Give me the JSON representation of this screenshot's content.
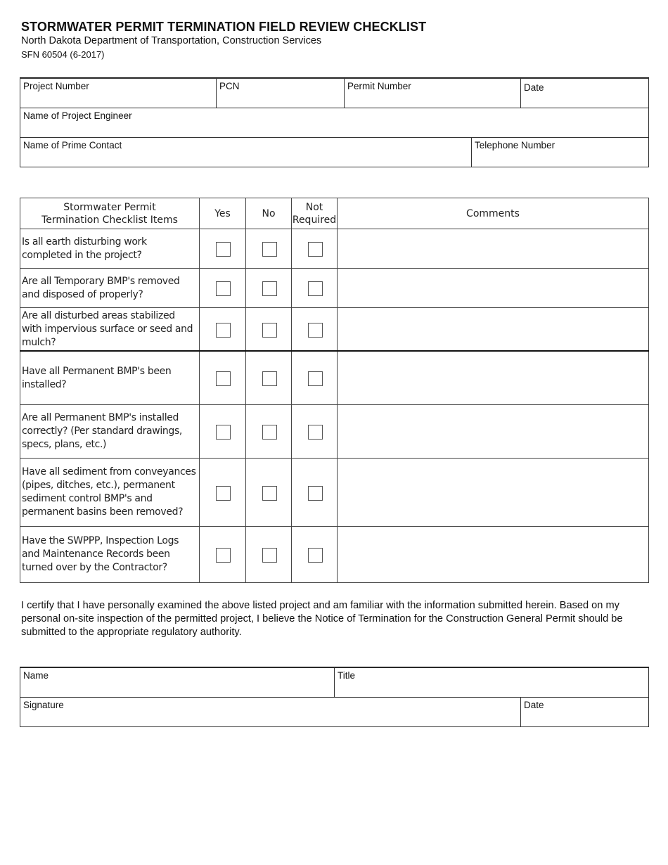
{
  "header": {
    "title": "STORMWATER PERMIT TERMINATION FIELD REVIEW CHECKLIST",
    "subtitle": "North Dakota Department of Transportation, Construction Services",
    "form_number": "SFN 60504 (6-2017)"
  },
  "project_info": {
    "project_number": {
      "label": "Project Number",
      "value": ""
    },
    "pcn": {
      "label": "PCN",
      "value": ""
    },
    "permit_number": {
      "label": "Permit Number",
      "value": ""
    },
    "date": {
      "label": "Date",
      "value": ""
    },
    "project_engineer": {
      "label": "Name of Project Engineer",
      "value": ""
    },
    "prime_contact": {
      "label": "Name of Prime Contact",
      "value": ""
    },
    "telephone": {
      "label": "Telephone Number",
      "value": ""
    }
  },
  "checklist": {
    "columns": {
      "item_line1": "Stormwater Permit",
      "item_line2": "Termination Checklist Items",
      "yes": "Yes",
      "no": "No",
      "not_required_line1": "Not",
      "not_required_line2": "Required",
      "comments": "Comments"
    },
    "rows": [
      {
        "question": "Is all earth disturbing work completed in the project?",
        "yes": false,
        "no": false,
        "not_required": false,
        "comments": ""
      },
      {
        "question": "Are all Temporary BMP's removed and disposed of properly?",
        "yes": false,
        "no": false,
        "not_required": false,
        "comments": ""
      },
      {
        "question": "Are all disturbed areas stabilized with impervious surface or seed and mulch?",
        "yes": false,
        "no": false,
        "not_required": false,
        "comments": ""
      },
      {
        "question": "Have all Permanent BMP's been installed?",
        "yes": false,
        "no": false,
        "not_required": false,
        "comments": ""
      },
      {
        "question": "Are all Permanent BMP's installed correctly? (Per standard drawings, specs, plans, etc.)",
        "yes": false,
        "no": false,
        "not_required": false,
        "comments": ""
      },
      {
        "question": "Have all sediment from conveyances (pipes, ditches, etc.), permanent sediment control BMP's and permanent basins been removed?",
        "yes": false,
        "no": false,
        "not_required": false,
        "comments": ""
      },
      {
        "question": "Have the SWPPP, Inspection Logs and Maintenance Records been turned over by the Contractor?",
        "yes": false,
        "no": false,
        "not_required": false,
        "comments": ""
      }
    ]
  },
  "certification": {
    "text": "I certify that I have personally examined the above listed project and am familiar with the information submitted herein.  Based on my personal on-site inspection of the permitted project, I believe the Notice of Termination for the Construction General Permit should be submitted to the appropriate regulatory authority."
  },
  "signature_block": {
    "name": {
      "label": "Name",
      "value": ""
    },
    "title": {
      "label": "Title",
      "value": ""
    },
    "signature": {
      "label": "Signature",
      "value": ""
    },
    "date": {
      "label": "Date",
      "value": ""
    }
  }
}
